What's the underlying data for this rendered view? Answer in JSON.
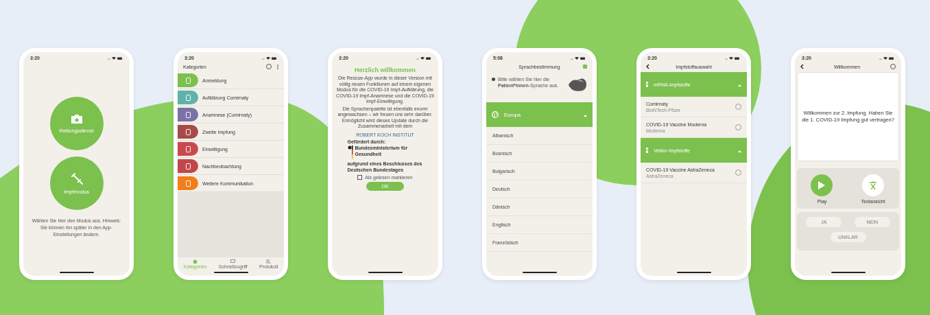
{
  "phones": [
    {
      "kind": "mode",
      "time": "3:20",
      "buttons": [
        "Rettungsdienst",
        "Impfmodus"
      ],
      "hint": "Wählen Sie hier den Modus aus. Hinweis: Sie können ihn später in den App-Einstellungen ändern."
    },
    {
      "kind": "categories",
      "time": "3:20",
      "title": "Kategorien",
      "items": [
        {
          "label": "Anmeldung",
          "color": "#7cc04e"
        },
        {
          "label": "Aufklärung Comirnaty",
          "color": "#5fb3a8"
        },
        {
          "label": "Anamnese (Comirnaty)",
          "color": "#7a72a6"
        },
        {
          "label": "Zweite Impfung",
          "color": "#a94a4a"
        },
        {
          "label": "Einwilligung",
          "color": "#c94a4e"
        },
        {
          "label": "Nachbeobachtung",
          "color": "#c2474c"
        },
        {
          "label": "Weitere Kommunikation",
          "color": "#f07f1a"
        }
      ],
      "tabs": [
        {
          "label": "Kategorien",
          "selected": true
        },
        {
          "label": "Schnellzugriff",
          "selected": false
        },
        {
          "label": "Protokoll",
          "selected": false
        }
      ]
    },
    {
      "kind": "welcome",
      "time": "3:20",
      "title": "Herzlich willkommen",
      "paragraphs": [
        "Die Rescue-App wurde in dieser Version mit völlig neuen Funktionen auf einem eigenen Modus für die COVID-19 Impf-Aufklärung, die COVID-19 Impf-Anamnese und die COVID-19 Impf-Einwilligung.",
        "Die Sprachenpalette ist ebenfalls enorm angewachsen – wir freuen uns sehr darüber. Ermöglicht wird dieses Update durch die Zusammenarbeit mit dem"
      ],
      "institute": "ROBERT KOCH INSTITUT",
      "funded": "Gefördert durch:",
      "ministry": "Bundesministerium für Gesundheit",
      "resolution": "aufgrund eines Beschlusses des Deutschen Bundestages",
      "checkbox": {
        "label": "Als gelesen markieren",
        "checked": false
      },
      "button": "OK"
    },
    {
      "kind": "language",
      "time": "5:08",
      "title": "Sprachbestimmung",
      "note": "Bitte wählen Sie hier die **Patient*innen**-Sprache aus.",
      "group": {
        "label": "Europa",
        "expanded": true
      },
      "languages": [
        "Albanisch",
        "Bosnisch",
        "Bulgarisch",
        "Deutsch",
        "Dänisch",
        "Englisch",
        "Französisch"
      ]
    },
    {
      "kind": "vaccine",
      "time": "3:20",
      "title": "Impfstoffauswahl",
      "groups": [
        {
          "label": "mRNA-Impfstoffe",
          "expanded": true,
          "items": [
            {
              "name": "Comirnaty",
              "maker": "BioNTech-Pfizer",
              "selected": false
            },
            {
              "name": "COVID-19 Vaccine Moderna",
              "maker": "Moderna",
              "selected": false
            }
          ]
        },
        {
          "label": "Vektor-Impfstoffe",
          "expanded": true,
          "items": [
            {
              "name": "COVID-19 Vaccine AstraZeneca",
              "maker": "AstraZeneca",
              "selected": false
            }
          ]
        }
      ]
    },
    {
      "kind": "question",
      "time": "3:20",
      "title": "Willkommen",
      "question": "Willkommen zur 2. Impfung. Haben Sie die 1. COVID-19 Impfung gut vertragen?",
      "actions": [
        "Play",
        "Textansicht"
      ],
      "answers": [
        "JA",
        "NEIN",
        "UNKLAR"
      ]
    }
  ]
}
